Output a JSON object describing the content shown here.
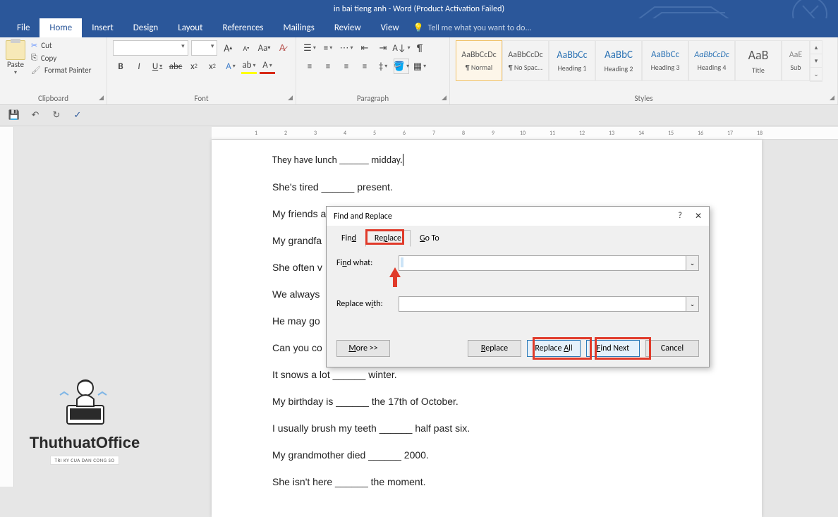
{
  "title": "in bai tieng anh - Word (Product Activation Failed)",
  "tabs": {
    "file": "File",
    "home": "Home",
    "insert": "Insert",
    "design": "Design",
    "layout": "Layout",
    "references": "References",
    "mailings": "Mailings",
    "review": "Review",
    "view": "View"
  },
  "tellme": "Tell me what you want to do...",
  "clipboard": {
    "paste": "Paste",
    "cut": "Cut",
    "copy": "Copy",
    "format_painter": "Format Painter",
    "label": "Clipboard"
  },
  "font": {
    "label": "Font"
  },
  "paragraph": {
    "label": "Paragraph"
  },
  "styles": {
    "label": "Styles",
    "items": [
      {
        "sample": "AaBbCcDc",
        "name": "¶ Normal"
      },
      {
        "sample": "AaBbCcDc",
        "name": "¶ No Spac..."
      },
      {
        "sample": "AaBbCc",
        "name": "Heading 1"
      },
      {
        "sample": "AaBbC",
        "name": "Heading 2"
      },
      {
        "sample": "AaBbCc",
        "name": "Heading 3"
      },
      {
        "sample": "AaBbCcDc",
        "name": "Heading 4"
      },
      {
        "sample": "AaB",
        "name": "Title"
      },
      {
        "sample": "AaE",
        "name": "Sub"
      }
    ]
  },
  "ruler": [
    "",
    "1",
    "2",
    "3",
    "4",
    "5",
    "6",
    "7",
    "8",
    "9",
    "10",
    "11",
    "12",
    "13",
    "14",
    "15",
    "16",
    "17",
    "18"
  ],
  "doc": {
    "lines": [
      "They have lunch ______ midday.",
      "She's tired ______ present.",
      "My friends a",
      "My grandfa",
      "She often v",
      "We always",
      "He may go",
      "Can you co",
      "It snows a lot ______ winter.",
      "My birthday is ______ the 17th of October.",
      "I usually brush my teeth ______ half past six.",
      "My grandmother died ______ 2000.",
      "She isn't here ______ the moment."
    ]
  },
  "dialog": {
    "title": "Find and Replace",
    "tabs": {
      "find": "Find",
      "replace": "Replace",
      "goto": "Go To"
    },
    "find_what": "Find what:",
    "replace_with": "Replace with:",
    "more": "More >>",
    "replace": "Replace",
    "replace_all": "Replace All",
    "find_next": "Find Next",
    "cancel": "Cancel"
  },
  "watermark": {
    "text": "ThuthuatOffice",
    "sub": "TRI KY CUA DAN CONG SO"
  }
}
